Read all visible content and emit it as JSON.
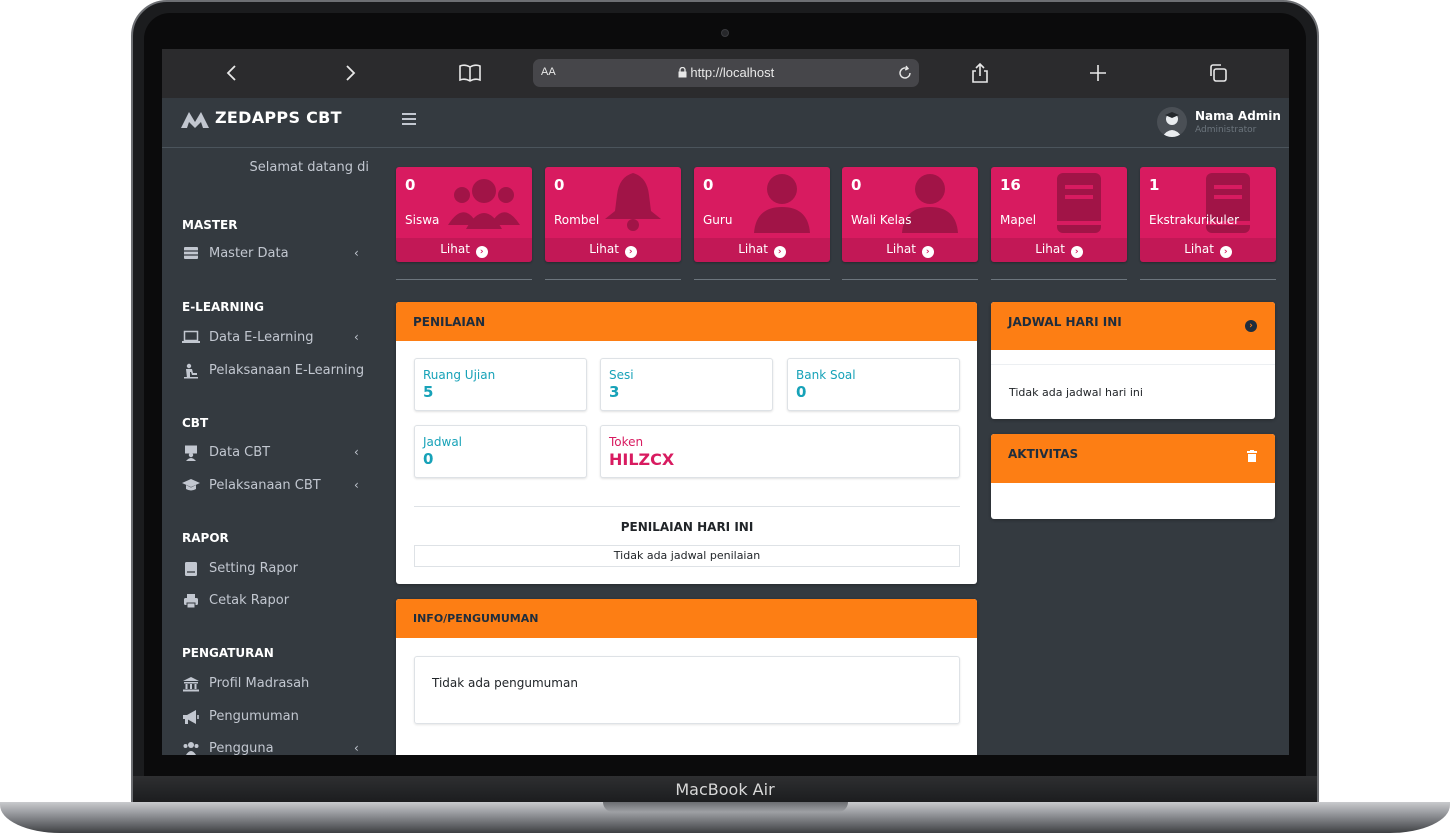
{
  "device": {
    "label": "MacBook Air"
  },
  "browser": {
    "back_icon": "‹",
    "forward_icon": "›",
    "aa_label": "AA",
    "url": "http://localhost"
  },
  "app": {
    "brand": "ZEDAPPS CBT",
    "welcome": "Selamat datang di",
    "user": {
      "name": "Nama Admin",
      "role": "Administrator"
    }
  },
  "sidebar": {
    "sections": [
      {
        "header": "MASTER",
        "items": [
          {
            "label": "Master Data",
            "icon": "table-icon",
            "caret": "‹"
          }
        ]
      },
      {
        "header": "E-LEARNING",
        "items": [
          {
            "label": "Data E-Learning",
            "icon": "laptop-icon",
            "caret": "‹"
          },
          {
            "label": "Pelaksanaan E-Learning",
            "icon": "chalkboard-icon",
            "caret": ""
          }
        ]
      },
      {
        "header": "CBT",
        "items": [
          {
            "label": "Data CBT",
            "icon": "teacher-icon",
            "caret": "‹"
          },
          {
            "label": "Pelaksanaan CBT",
            "icon": "graduation-cap-icon",
            "caret": "‹"
          }
        ]
      },
      {
        "header": "RAPOR",
        "items": [
          {
            "label": "Setting Rapor",
            "icon": "book-icon",
            "caret": ""
          },
          {
            "label": "Cetak Rapor",
            "icon": "print-icon",
            "caret": ""
          }
        ]
      },
      {
        "header": "PENGATURAN",
        "items": [
          {
            "label": "Profil Madrasah",
            "icon": "institution-icon",
            "caret": ""
          },
          {
            "label": "Pengumuman",
            "icon": "bullhorn-icon",
            "caret": ""
          },
          {
            "label": "Pengguna",
            "icon": "users-icon",
            "caret": "‹"
          }
        ]
      }
    ]
  },
  "summary_boxes": [
    {
      "value": "0",
      "label": "Siswa",
      "link": "Lihat",
      "icon": "users-icon"
    },
    {
      "value": "0",
      "label": "Rombel",
      "link": "Lihat",
      "icon": "bell-icon"
    },
    {
      "value": "0",
      "label": "Guru",
      "link": "Lihat",
      "icon": "user-icon"
    },
    {
      "value": "0",
      "label": "Wali Kelas",
      "link": "Lihat",
      "icon": "user-icon"
    },
    {
      "value": "16",
      "label": "Mapel",
      "link": "Lihat",
      "icon": "book-icon"
    },
    {
      "value": "1",
      "label": "Ekstrakurikuler",
      "link": "Lihat",
      "icon": "book-icon"
    }
  ],
  "penilaian": {
    "title": "PENILAIAN",
    "stats": [
      {
        "label": "Ruang Ujian",
        "value": "5"
      },
      {
        "label": "Sesi",
        "value": "3"
      },
      {
        "label": "Bank Soal",
        "value": "0"
      },
      {
        "label": "Jadwal",
        "value": "0"
      },
      {
        "label": "Token",
        "value": "HILZCX"
      }
    ],
    "today_title": "PENILAIAN HARI INI",
    "today_empty": "Tidak ada jadwal penilaian"
  },
  "info": {
    "title": "INFO/PENGUMUMAN",
    "empty": "Tidak ada pengumuman"
  },
  "jadwal": {
    "title": "JADWAL HARI INI",
    "empty": "Tidak ada jadwal hari ini"
  },
  "aktivitas": {
    "title": "AKTIVITAS"
  },
  "colors": {
    "accent": "#fd7e14",
    "pink": "#d81b60",
    "sidebar": "#343a40",
    "info": "#17a2b8"
  }
}
